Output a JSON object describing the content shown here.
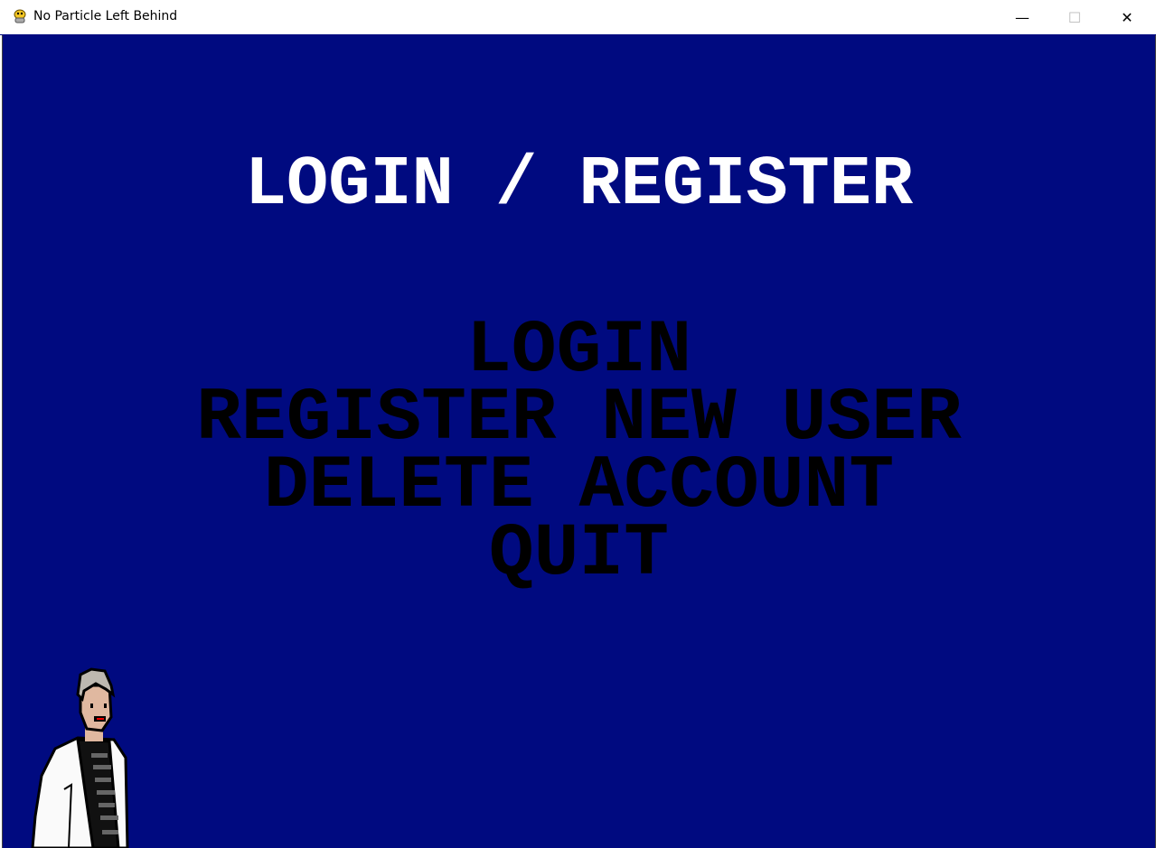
{
  "window": {
    "title": "No Particle Left Behind",
    "minimize": "—",
    "maximize": "☐",
    "close": "✕"
  },
  "screen": {
    "heading": "LOGIN / REGISTER",
    "menu": [
      {
        "label": "LOGIN"
      },
      {
        "label": "REGISTER NEW USER"
      },
      {
        "label": "DELETE ACCOUNT"
      },
      {
        "label": "QUIT"
      }
    ]
  },
  "colors": {
    "background": "#000a80",
    "heading": "#ffffff",
    "menu": "#000000"
  }
}
